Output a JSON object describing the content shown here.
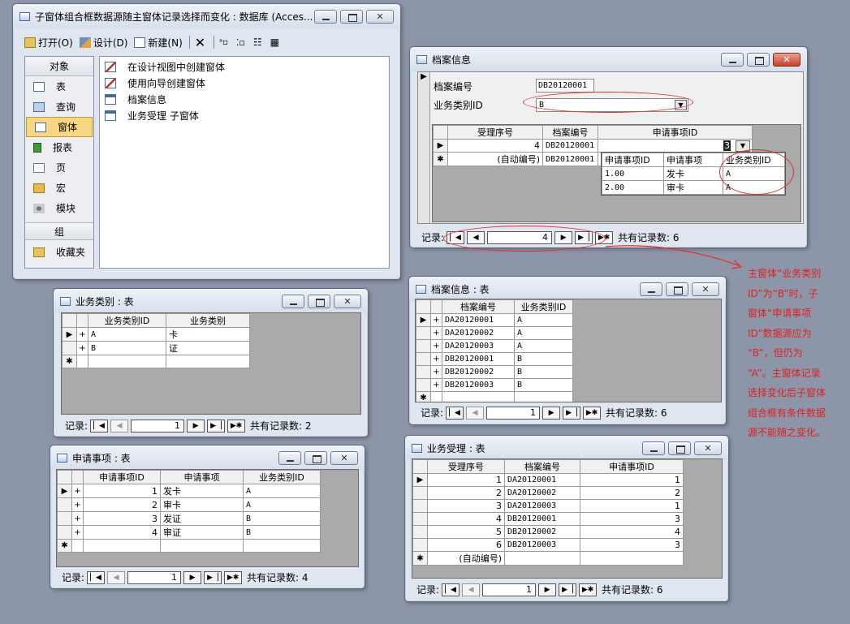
{
  "db_window": {
    "title": "子窗体组合框数据源随主窗体记录选择而变化 : 数据库 (Acces...",
    "toolbar": {
      "open": "打开(O)",
      "design": "设计(D)",
      "new": "新建(N)"
    },
    "objects_header": "对象",
    "objects": [
      "表",
      "查询",
      "窗体",
      "报表",
      "页",
      "宏",
      "模块"
    ],
    "groups_header": "组",
    "groups": [
      "收藏夹"
    ],
    "list": [
      "在设计视图中创建窗体",
      "使用向导创建窗体",
      "档案信息",
      "业务受理 子窗体"
    ]
  },
  "archive_form": {
    "title": "档案信息",
    "archive_no_label": "档案编号",
    "archive_no_value": "DB20120001",
    "biz_type_label": "业务类别ID",
    "biz_type_value": "B",
    "sub_columns": [
      "受理序号",
      "档案编号",
      "申请事项ID"
    ],
    "sub_rows": [
      [
        "4",
        "DB20120001",
        "3"
      ],
      [
        "(自动编号)",
        "DB20120001",
        ""
      ]
    ],
    "dropdown_columns": [
      "申请事项ID",
      "申请事项",
      "业务类别ID"
    ],
    "dropdown_rows": [
      [
        "1.00",
        "发卡",
        "A"
      ],
      [
        "2.00",
        "审卡",
        "A"
      ]
    ],
    "nav": {
      "label": "记录:",
      "current": "4",
      "total": "共有记录数: 6"
    }
  },
  "biz_type_table": {
    "title": "业务类别 : 表",
    "columns": [
      "业务类别ID",
      "业务类别"
    ],
    "rows": [
      [
        "A",
        "卡"
      ],
      [
        "B",
        "证"
      ]
    ],
    "nav": {
      "label": "记录:",
      "current": "1",
      "total": "共有记录数: 2"
    }
  },
  "request_table": {
    "title": "申请事项 : 表",
    "columns": [
      "申请事项ID",
      "申请事项",
      "业务类别ID"
    ],
    "rows": [
      [
        "1",
        "发卡",
        "A"
      ],
      [
        "2",
        "审卡",
        "A"
      ],
      [
        "3",
        "发证",
        "B"
      ],
      [
        "4",
        "审证",
        "B"
      ]
    ],
    "nav": {
      "label": "记录:",
      "current": "1",
      "total": "共有记录数: 4"
    }
  },
  "archive_table": {
    "title": "档案信息 : 表",
    "columns": [
      "档案编号",
      "业务类别ID"
    ],
    "rows": [
      [
        "DA20120001",
        "A"
      ],
      [
        "DA20120002",
        "A"
      ],
      [
        "DA20120003",
        "A"
      ],
      [
        "DB20120001",
        "B"
      ],
      [
        "DB20120002",
        "B"
      ],
      [
        "DB20120003",
        "B"
      ]
    ],
    "nav": {
      "label": "记录:",
      "current": "1",
      "total": "共有记录数: 6"
    }
  },
  "biz_accept_table": {
    "title": "业务受理 : 表",
    "columns": [
      "受理序号",
      "档案编号",
      "申请事项ID"
    ],
    "rows": [
      [
        "1",
        "DA20120001",
        "1"
      ],
      [
        "2",
        "DA20120002",
        "2"
      ],
      [
        "3",
        "DA20120003",
        "1"
      ],
      [
        "4",
        "DB20120001",
        "3"
      ],
      [
        "5",
        "DB20120002",
        "4"
      ],
      [
        "6",
        "DB20120003",
        "3"
      ]
    ],
    "new_row": "(自动编号)",
    "nav": {
      "label": "记录:",
      "current": "1",
      "total": "共有记录数: 6"
    }
  },
  "annotation_lines": [
    "主窗体“业务类别",
    "ID”为“B”时，子",
    "窗体“申请事项",
    "ID”数据源应为",
    "“B”，但仍为",
    "“A”。主窗体记录",
    "选择变化后子窗体",
    "组合框有条件数据",
    "源不能随之变化。"
  ],
  "colors": {
    "annotation": "#e02020",
    "desktop": "#8d95a8"
  }
}
